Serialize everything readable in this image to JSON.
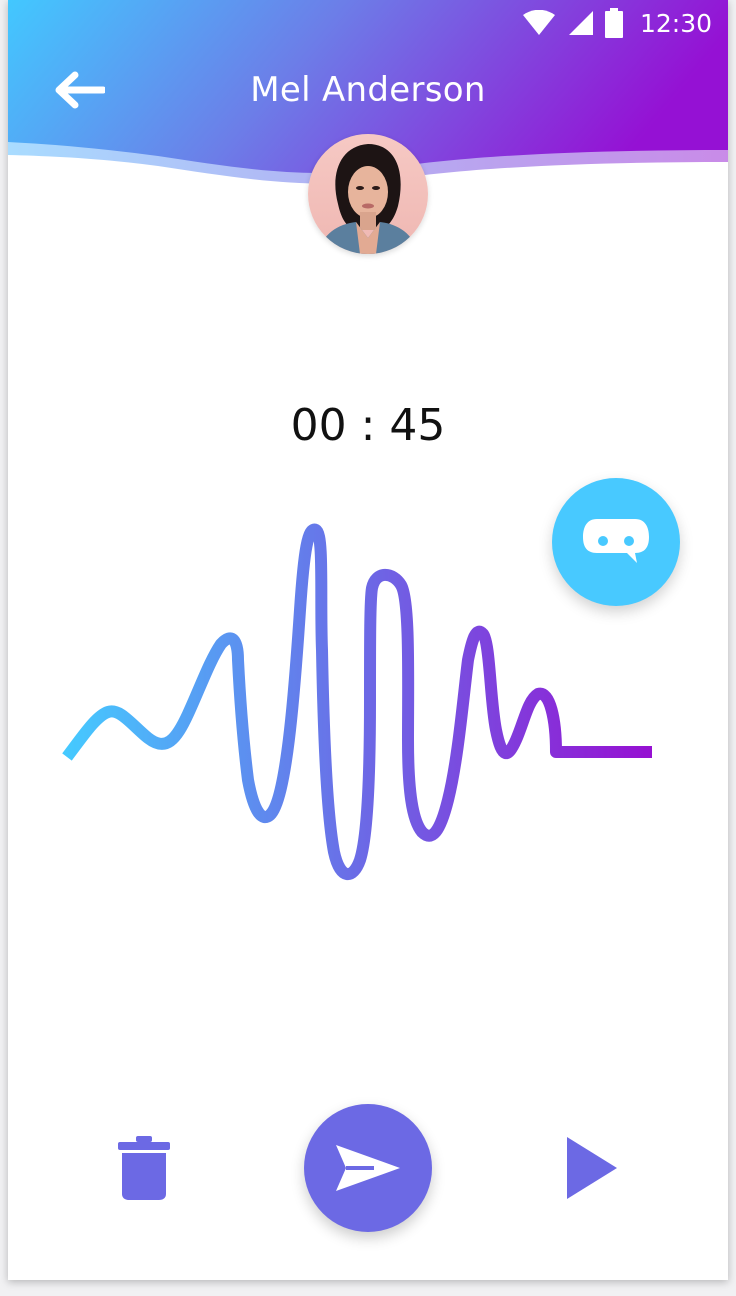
{
  "status_bar": {
    "time": "12:30",
    "icons": [
      "wifi-icon",
      "signal-icon",
      "battery-icon"
    ]
  },
  "header": {
    "back_icon": "arrow-left-icon",
    "title": "Mel Anderson",
    "gradient_start": "#42c8ff",
    "gradient_end": "#9511d4"
  },
  "recording": {
    "elapsed": "00 : 45",
    "wave_color_start": "#45caff",
    "wave_color_end": "#9610d2"
  },
  "actions": {
    "chat_bot_icon": "chat-bubble-icon",
    "delete_icon": "trash-icon",
    "send_icon": "send-icon",
    "play_icon": "play-icon",
    "accent": "#6c69e4",
    "chat_accent": "#48c9ff"
  }
}
